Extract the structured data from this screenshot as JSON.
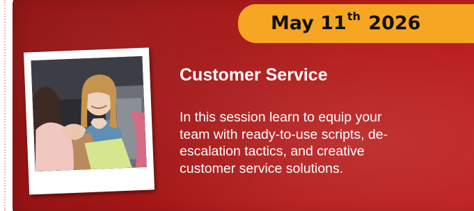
{
  "event": {
    "date_prefix": "May 11",
    "date_ordinal": "th",
    "date_year": "2026",
    "title": "Customer Service",
    "description_lines": [
      "In this session learn to equip your",
      "team with ready-to-use scripts, de-",
      "escalation tactics, and creative",
      "customer service solutions."
    ]
  },
  "colors": {
    "panel_red": "#a51717",
    "date_badge": "#f6a623",
    "text": "#ffffff"
  },
  "icons": {
    "photo": "shopping-customer-photo"
  }
}
